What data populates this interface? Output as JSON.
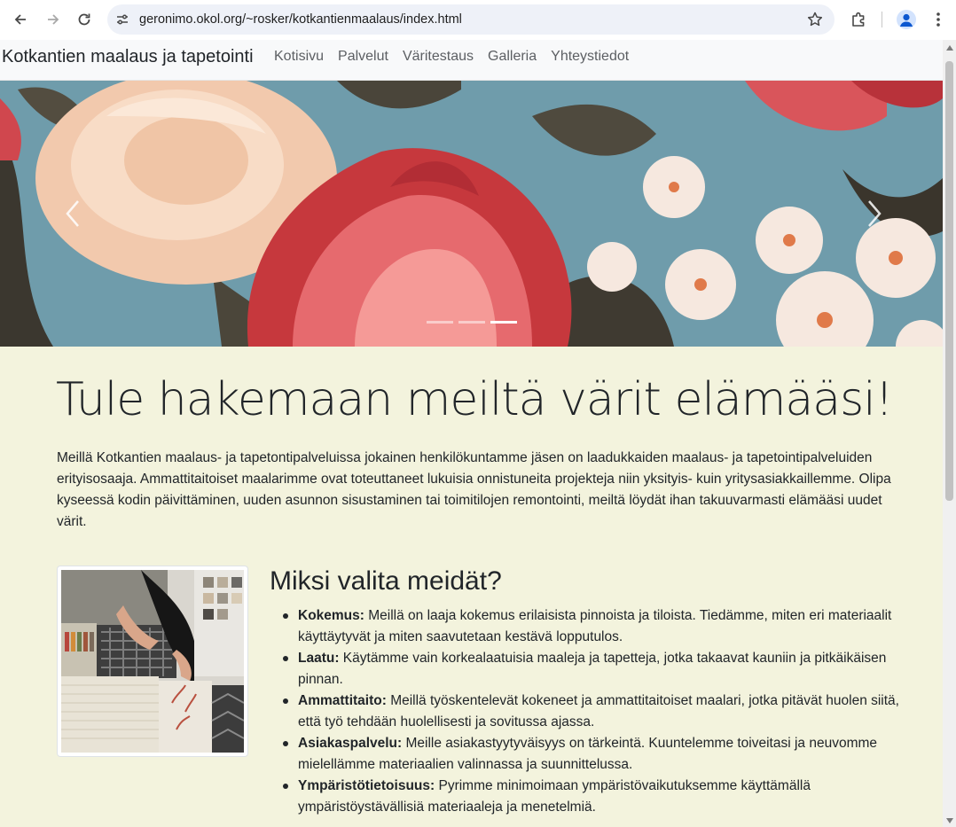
{
  "browser": {
    "url": "geronimo.okol.org/~rosker/kotkantienmaalaus/index.html"
  },
  "site": {
    "brand": "Kotkantien maalaus ja tapetointi",
    "nav": [
      "Kotisivu",
      "Palvelut",
      "Väritestaus",
      "Galleria",
      "Yhteystiedot"
    ]
  },
  "carousel": {
    "slide_count": 3,
    "active_index": 2
  },
  "main": {
    "headline": "Tule hakemaan meiltä värit elämääsi!",
    "intro": "Meillä Kotkantien maalaus- ja tapetontipalveluissa jokainen henkilökuntamme jäsen on laadukkaiden maalaus- ja tapetointipalveluiden erityisosaaja. Ammattitaitoiset maalarimme ovat toteuttaneet lukuisia onnistuneita projekteja niin yksityis- kuin yritysasiakkaillemme. Olipa kyseessä kodin päivittäminen, uuden asunnon sisustaminen tai toimitilojen remontointi, meiltä löydät ihan takuuvarmasti elämääsi uudet värit.",
    "why_title": "Miksi valita meidät?",
    "why_items": [
      {
        "term": "Kokemus:",
        "text": " Meillä on laaja kokemus erilaisista pinnoista ja tiloista. Tiedämme, miten eri materiaalit käyttäytyvät ja miten saavutetaan kestävä lopputulos."
      },
      {
        "term": "Laatu:",
        "text": " Käytämme vain korkealaatuisia maaleja ja tapetteja, jotka takaavat kauniin ja pitkäikäisen pinnan."
      },
      {
        "term": "Ammattitaito:",
        "text": " Meillä työskentelevät kokeneet ja ammattitaitoiset maalari, jotka pitävät huolen siitä, että työ tehdään huolellisesti ja sovitussa ajassa."
      },
      {
        "term": "Asiakaspalvelu:",
        "text": " Meille asiakastyytyväisyys on tärkeintä. Kuuntelemme toiveitasi ja neuvomme mielellämme materiaalien valinnassa ja suunnittelussa."
      },
      {
        "term": "Ympäristötietoisuus:",
        "text": " Pyrimme minimoimaan ympäristövaikutuksemme käyttämällä ympäristöystävällisiä materiaaleja ja menetelmiä."
      }
    ]
  },
  "colors": {
    "page_bg": "#f3f3dd",
    "nav_bg": "#f8f9fa",
    "text": "#212529"
  },
  "icons": [
    "back-icon",
    "forward-icon",
    "reload-icon",
    "site-info-icon",
    "bookmark-star-icon",
    "extensions-icon",
    "profile-icon",
    "menu-kebab-icon",
    "carousel-prev-icon",
    "carousel-next-icon"
  ]
}
